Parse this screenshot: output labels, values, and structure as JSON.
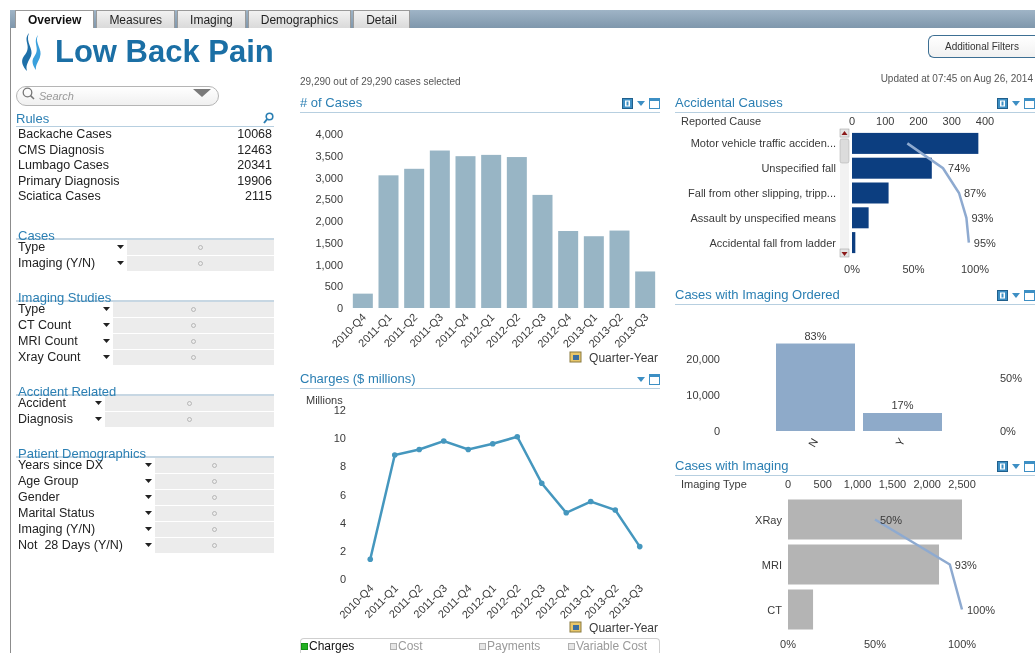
{
  "tabs": [
    {
      "label": "Overview",
      "selected": true
    },
    {
      "label": "Measures",
      "selected": false
    },
    {
      "label": "Imaging",
      "selected": false
    },
    {
      "label": "Demographics",
      "selected": false
    },
    {
      "label": "Detail",
      "selected": false
    }
  ],
  "app_title": "Low Back Pain",
  "search": {
    "placeholder": "Search"
  },
  "rules": {
    "title": "Rules",
    "items": [
      {
        "label": "Backache Cases",
        "count": "10068"
      },
      {
        "label": "CMS Diagnosis",
        "count": "12463"
      },
      {
        "label": "Lumbago Cases",
        "count": "20341"
      },
      {
        "label": "Primary Diagnosis",
        "count": "19906"
      },
      {
        "label": "Sciatica Cases",
        "count": "2115"
      }
    ]
  },
  "filter_groups": [
    {
      "title": "Cases",
      "fields": [
        "Type",
        "Imaging (Y/N)"
      ]
    },
    {
      "title": "Imaging Studies",
      "fields": [
        "Type",
        "CT Count",
        "MRI Count",
        "Xray Count"
      ]
    },
    {
      "title": "Accident Related",
      "fields": [
        "Accident",
        "Diagnosis"
      ]
    },
    {
      "title": "Patient Demographics",
      "fields": [
        "Years since DX",
        "Age Group",
        "Gender",
        "Marital Status",
        "Imaging (Y/N)",
        "Not  28 Days (Y/N)"
      ]
    }
  ],
  "selection_status": "29,290 out of 29,290 cases selected",
  "additional_filters_button": "Additional Filters",
  "updated": "Updated at 07:45 on Aug 26, 2014",
  "cases_chart": {
    "title": "# of Cases",
    "chart_data": {
      "type": "bar",
      "xlabel": "Quarter-Year",
      "categories": [
        "2010-Q4",
        "2011-Q1",
        "2011-Q2",
        "2011-Q3",
        "2011-Q4",
        "2012-Q1",
        "2012-Q2",
        "2012-Q3",
        "2012-Q4",
        "2013-Q1",
        "2013-Q2",
        "2013-Q3"
      ],
      "values": [
        330,
        3050,
        3200,
        3620,
        3490,
        3520,
        3470,
        2600,
        1770,
        1650,
        1780,
        840
      ],
      "ylim": [
        0,
        4000
      ],
      "yticks": [
        {
          "value": 0,
          "label": "0"
        },
        {
          "value": 500,
          "label": "500"
        },
        {
          "value": 1000,
          "label": "1,000"
        },
        {
          "value": 1500,
          "label": "1,500"
        },
        {
          "value": 2000,
          "label": "2,000"
        },
        {
          "value": 2500,
          "label": "2,500"
        },
        {
          "value": 3000,
          "label": "3,000"
        },
        {
          "value": 3500,
          "label": "3,500"
        },
        {
          "value": 4000,
          "label": "4,000"
        }
      ]
    }
  },
  "charges_chart": {
    "title": "Charges ($ millions)",
    "chart_data": {
      "type": "line",
      "ylabel": "Millions",
      "xlabel": "Quarter-Year",
      "categories": [
        "2010-Q4",
        "2011-Q1",
        "2011-Q2",
        "2011-Q3",
        "2011-Q4",
        "2012-Q1",
        "2012-Q2",
        "2012-Q3",
        "2012-Q4",
        "2013-Q1",
        "2013-Q2",
        "2013-Q3"
      ],
      "values": [
        1.4,
        8.8,
        9.2,
        9.8,
        9.2,
        9.6,
        10.1,
        6.8,
        4.7,
        5.5,
        4.9,
        2.3
      ],
      "ylim": [
        0,
        12
      ],
      "yticks": [
        0,
        2,
        4,
        6,
        8,
        10,
        12
      ]
    },
    "legend": [
      {
        "label": "Charges",
        "selected": true
      },
      {
        "label": "Cost",
        "selected": false
      },
      {
        "label": "Payments",
        "selected": false
      },
      {
        "label": "Variable Cost",
        "selected": false
      }
    ]
  },
  "accidental_causes": {
    "title": "Accidental Causes",
    "share_ticks": [
      "0%",
      "50%",
      "100%"
    ],
    "chart_data": {
      "type": "bar",
      "orientation": "horizontal",
      "ylabel": "Reported Cause",
      "categories": [
        "Motor vehicle traffic acciden...",
        "Unspecified fall",
        "Fall from other slipping, tripp...",
        "Assault by unspecified means",
        "Accidental fall from ladder"
      ],
      "series": [
        {
          "color": "#0c3e80",
          "values": [
            380,
            240,
            110,
            50,
            10
          ]
        },
        {
          "color": "#8eaad0",
          "values": [
            0.45,
            0.74,
            0.87,
            0.93,
            0.95
          ]
        }
      ],
      "xlim": [
        0,
        400
      ],
      "xticks": [
        0,
        100,
        200,
        300,
        400
      ],
      "annotations": [
        "74%",
        "87%",
        "93%",
        "95%"
      ]
    }
  },
  "imaging_ordered": {
    "title": "Cases with Imaging Ordered",
    "share_ticks": [
      "50%",
      "0%"
    ],
    "share_labels": [
      "83%",
      "17%"
    ],
    "chart_data": {
      "type": "bar",
      "categories": [
        "N",
        "Y"
      ],
      "values": [
        24300,
        5000
      ],
      "ylim": [
        0,
        25000
      ],
      "yticks": [
        {
          "value": 0,
          "label": "0"
        },
        {
          "value": 10000,
          "label": "10,000"
        },
        {
          "value": 20000,
          "label": "20,000"
        }
      ]
    }
  },
  "imaging_types": {
    "title": "Cases with Imaging",
    "share_ticks": [
      "0%",
      "50%",
      "100%"
    ],
    "chart_data": {
      "type": "bar",
      "orientation": "horizontal",
      "ylabel": "Imaging Type",
      "categories": [
        "XRay",
        "MRI",
        "CT"
      ],
      "series": [
        {
          "color": "#b4b4b4",
          "values": [
            2500,
            2170,
            360
          ]
        },
        {
          "color": "#8eaad0",
          "values": [
            0.5,
            0.93,
            1.0
          ]
        }
      ],
      "xlim": [
        0,
        2500
      ],
      "xticks": [
        {
          "value": 0,
          "label": "0"
        },
        {
          "value": 500,
          "label": "500"
        },
        {
          "value": 1000,
          "label": "1,000"
        },
        {
          "value": 1500,
          "label": "1,500"
        },
        {
          "value": 2000,
          "label": "2,000"
        },
        {
          "value": 2500,
          "label": "2,500"
        }
      ],
      "annotations": [
        "50%",
        "93%",
        "100%"
      ]
    }
  }
}
